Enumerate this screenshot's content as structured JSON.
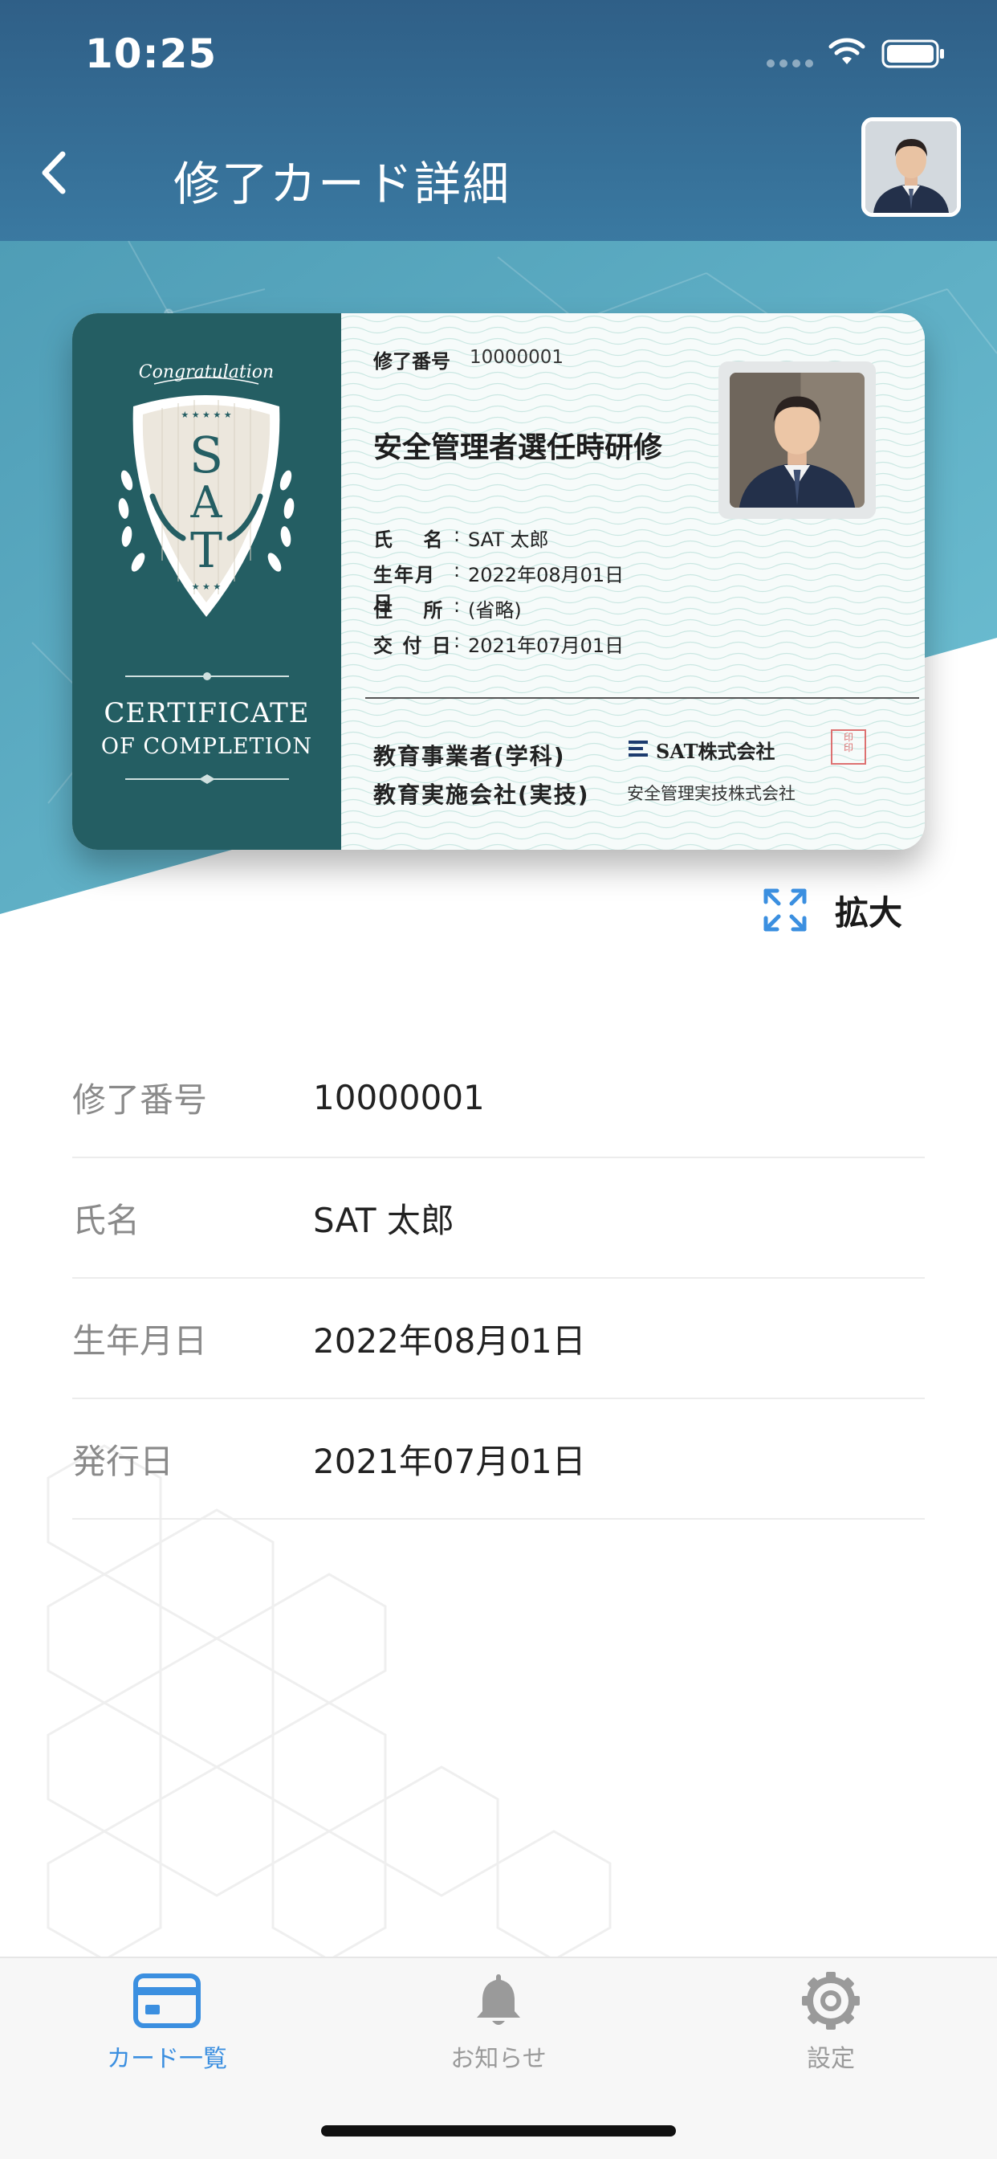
{
  "status_bar": {
    "time": "10:25"
  },
  "header": {
    "title": "修了カード詳細"
  },
  "card": {
    "left": {
      "emblem_script": "Congratulation",
      "emblem_letters": "SAT",
      "certificate_title": "CERTIFICATE",
      "certificate_subtitle": "OF COMPLETION"
    },
    "number_label": "修了番号",
    "number_value": "10000001",
    "course": "安全管理者選任時研修",
    "fields": [
      {
        "label": "氏　 名",
        "sep": ":",
        "value": "SAT 太郎"
      },
      {
        "label": "生年月日",
        "sep": ":",
        "value": "2022年08月01日"
      },
      {
        "label": "住　 所",
        "sep": ":",
        "value": "(省略)"
      },
      {
        "label": "交 付 日",
        "sep": ":",
        "value": "2021年07月01日"
      }
    ],
    "provider_label_1": "教育事業者(学科)",
    "provider_label_2": "教育実施会社(実技)",
    "provider_company_1": "SAT株式会社",
    "provider_company_2": "安全管理実技株式会社"
  },
  "expand": {
    "label": "拡大"
  },
  "info": [
    {
      "label": "修了番号",
      "value": "10000001"
    },
    {
      "label": "氏名",
      "value": "SAT 太郎"
    },
    {
      "label": "生年月日",
      "value": "2022年08月01日"
    },
    {
      "label": "発行日",
      "value": "2021年07月01日"
    }
  ],
  "tabs": [
    {
      "label": "カード一覧",
      "icon": "card-icon",
      "active": true
    },
    {
      "label": "お知らせ",
      "icon": "bell-icon",
      "active": false
    },
    {
      "label": "設定",
      "icon": "gear-icon",
      "active": false
    }
  ],
  "colors": {
    "header": "#2f5f87",
    "hero_teal": "#5aaec4",
    "card_left": "#245e63",
    "accent_blue": "#3b8fe0"
  }
}
